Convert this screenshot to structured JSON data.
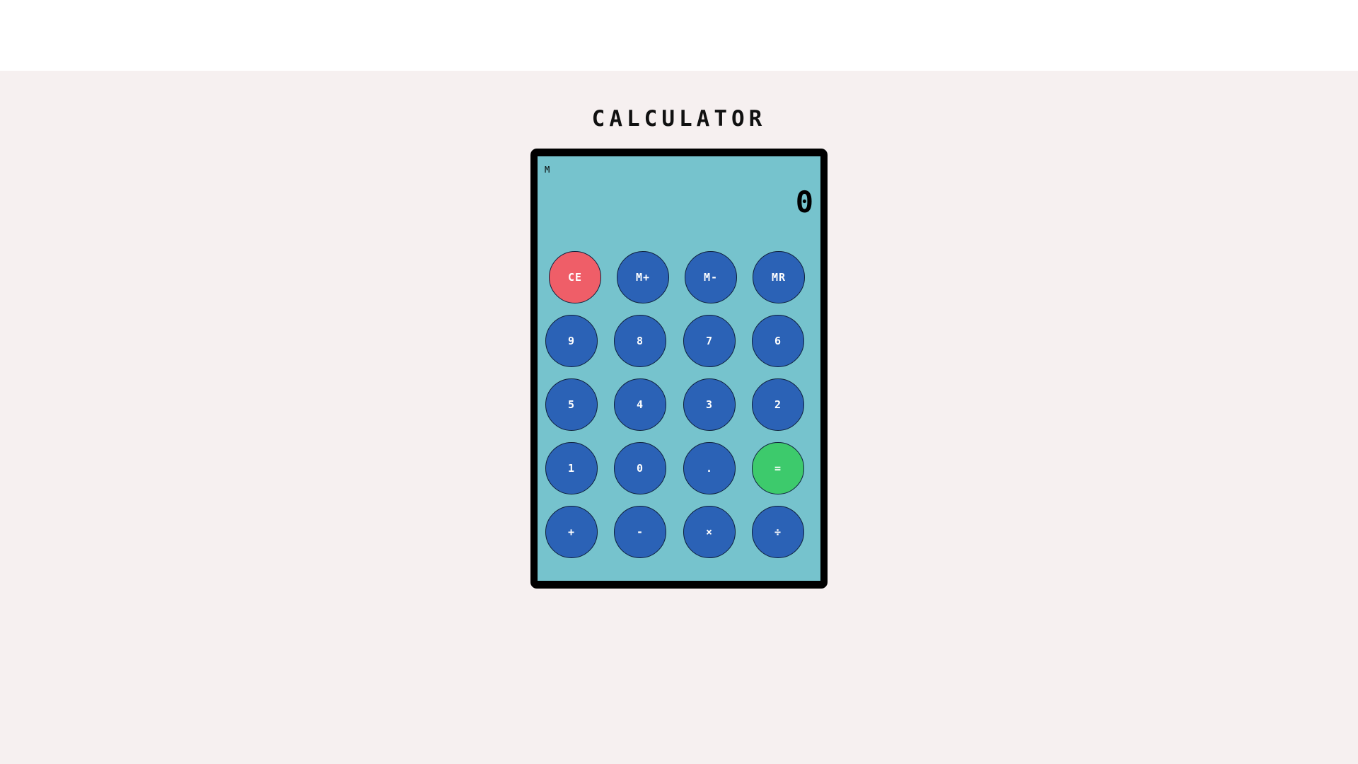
{
  "title": "CALCULATOR",
  "screen": {
    "memory_indicator": "M",
    "display_value": "0"
  },
  "colors": {
    "page_background": "#f6f0f0",
    "screen": "#76c3cd",
    "key_default": "#2b62b6",
    "key_clear": "#ef5e68",
    "key_equals": "#3dca6c"
  },
  "keys": {
    "clear": "CE",
    "mem_plus": "M+",
    "mem_minus": "M-",
    "mem_recall": "MR",
    "nine": "9",
    "eight": "8",
    "seven": "7",
    "six": "6",
    "five": "5",
    "four": "4",
    "three": "3",
    "two": "2",
    "one": "1",
    "zero": "0",
    "decimal": ".",
    "equals": "=",
    "add": "+",
    "subtract": "-",
    "multiply": "×",
    "divide": "÷"
  }
}
